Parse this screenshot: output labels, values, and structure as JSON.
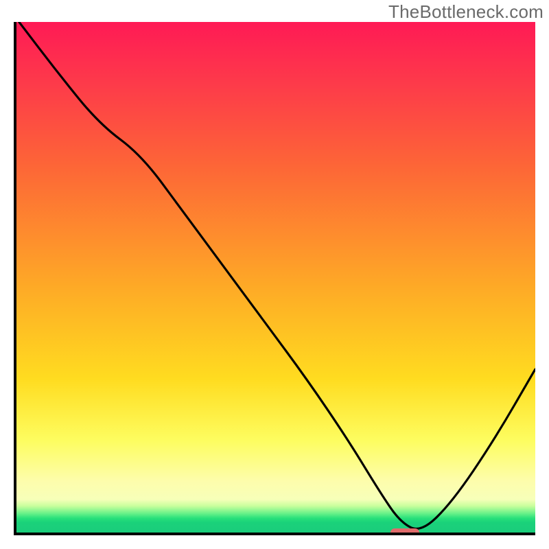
{
  "watermark": "TheBottleneck.com",
  "chart_data": {
    "type": "line",
    "title": "",
    "xlabel": "",
    "ylabel": "",
    "xlim": [
      0,
      100
    ],
    "ylim": [
      0,
      100
    ],
    "grid": false,
    "legend": false,
    "background": {
      "kind": "vertical-gradient",
      "stops": [
        {
          "pct": 0,
          "color": "#ff1a55"
        },
        {
          "pct": 12,
          "color": "#fd3a4a"
        },
        {
          "pct": 28,
          "color": "#fd6537"
        },
        {
          "pct": 52,
          "color": "#feaa26"
        },
        {
          "pct": 70,
          "color": "#ffdc20"
        },
        {
          "pct": 82,
          "color": "#fdfd60"
        },
        {
          "pct": 90,
          "color": "#fdfdac"
        },
        {
          "pct": 94,
          "color": "#c9ff9c"
        },
        {
          "pct": 96,
          "color": "#6cf28a"
        },
        {
          "pct": 98,
          "color": "#1ad27a"
        },
        {
          "pct": 100,
          "color": "#19ce7b"
        }
      ]
    },
    "series": [
      {
        "name": "bottleneck-curve",
        "color": "#000000",
        "x": [
          0.5,
          8,
          16,
          24,
          32,
          40,
          48,
          56,
          64,
          70,
          74,
          78,
          84,
          92,
          100
        ],
        "y": [
          100,
          90,
          80,
          74,
          63,
          52,
          41,
          30,
          18,
          8,
          2,
          0,
          6,
          18,
          32
        ]
      }
    ],
    "annotations": [
      {
        "name": "minimum-marker",
        "shape": "rounded-rect",
        "color": "#e06b6b",
        "x": 74.5,
        "y": 0.5,
        "width_pct": 5.6,
        "height_pct": 1.6
      }
    ],
    "optimal_x": 76
  }
}
